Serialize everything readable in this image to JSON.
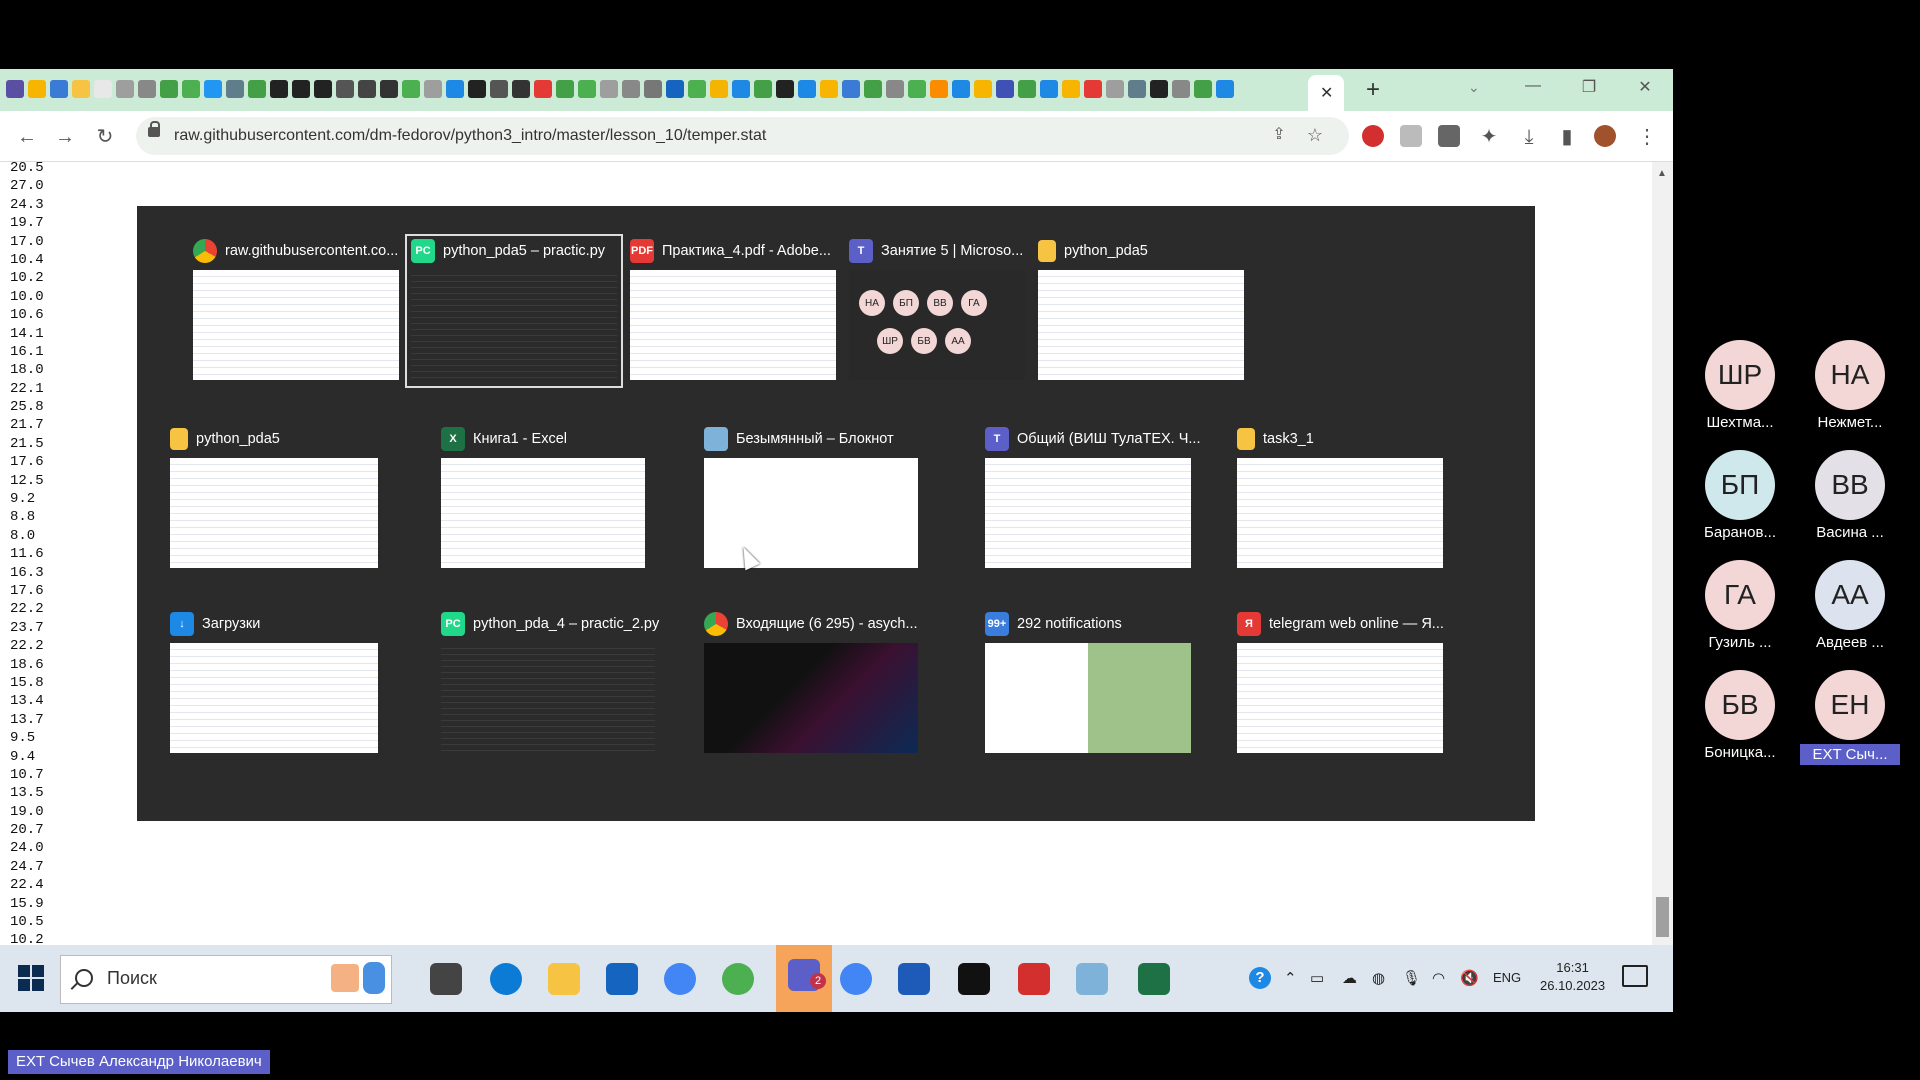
{
  "browser": {
    "active_tab_close": "✕",
    "new_tab": "+",
    "url": "raw.githubusercontent.com/dm-fedorov/python3_intro/master/lesson_10/temper.stat",
    "tab_favicon_colors": [
      "#5a4fa3",
      "#f7b500",
      "#3a7bd5",
      "#f6c343",
      "#e8e8e8",
      "#9e9e9e",
      "#888",
      "#43a047",
      "#4caf50",
      "#2196f3",
      "#607d8b",
      "#43a047",
      "#222",
      "#222",
      "#222",
      "#555",
      "#444",
      "#333",
      "#4caf50",
      "#9e9e9e",
      "#1e88e5",
      "#222",
      "#555",
      "#333",
      "#e53935",
      "#43a047",
      "#4caf50",
      "#9e9e9e",
      "#888",
      "#777",
      "#1565c0",
      "#4caf50",
      "#f4b400",
      "#1e88e5",
      "#43a047",
      "#222",
      "#1e88e5",
      "#f7b500",
      "#3a7bd5",
      "#43a047",
      "#888",
      "#4caf50",
      "#fb8c00",
      "#1e88e5",
      "#f7b500",
      "#3f51b5",
      "#43a047",
      "#1e88e5",
      "#f7b500",
      "#e53935",
      "#9e9e9e",
      "#607d8b",
      "#222",
      "#888",
      "#43a047",
      "#1e88e5"
    ]
  },
  "page": {
    "lines": [
      "20.5",
      "27.0",
      "24.3",
      "19.7",
      "17.0",
      "10.4",
      "10.2",
      "10.0",
      "10.6",
      "14.1",
      "16.1",
      "18.0",
      "22.1",
      "25.8",
      "21.7",
      "21.5",
      "17.6",
      "12.5",
      "9.2",
      "8.8",
      "8.0",
      "11.6",
      "16.3",
      "17.6",
      "22.2",
      "23.7",
      "22.2",
      "18.6",
      "15.8",
      "13.4",
      "13.7",
      "9.5",
      "9.4",
      "10.7",
      "13.5",
      "19.0",
      "20.7",
      "24.0",
      "24.7",
      "22.4",
      "15.9",
      "10.5",
      "10.2"
    ]
  },
  "switcher": {
    "windows": [
      {
        "title": "raw.githubusercontent.co...",
        "icon": "chrome-icon",
        "color": "#4285f4",
        "glyph": "",
        "thumb": "light"
      },
      {
        "title": "python_pda5 – practic.py",
        "icon": "pycharm-icon",
        "color": "#21d789",
        "glyph": "PC",
        "thumb": "dark"
      },
      {
        "title": "Практика_4.pdf - Adobe...",
        "icon": "acrobat-icon",
        "color": "#e53935",
        "glyph": "PDF",
        "thumb": "light"
      },
      {
        "title": "Занятие 5 | Microso...",
        "icon": "teams-icon",
        "color": "#5b5fc7",
        "glyph": "T",
        "thumb": "teams"
      },
      {
        "title": "python_pda5",
        "icon": "folder-icon",
        "color": "#f6c343",
        "glyph": "",
        "thumb": "light"
      },
      {
        "title": "python_pda5",
        "icon": "folder-icon",
        "color": "#f6c343",
        "glyph": "",
        "thumb": "light"
      },
      {
        "title": "Книга1 - Excel",
        "icon": "excel-icon",
        "color": "#1e7145",
        "glyph": "X",
        "thumb": "light"
      },
      {
        "title": "Безымянный – Блокнот",
        "icon": "notepad-icon",
        "color": "#7fb2d9",
        "glyph": "",
        "thumb": "white"
      },
      {
        "title": "Общий (ВИШ ТулаТЕХ. Ч...",
        "icon": "teams-icon",
        "color": "#5b5fc7",
        "glyph": "T",
        "thumb": "light"
      },
      {
        "title": "task3_1",
        "icon": "folder-icon",
        "color": "#f6c343",
        "glyph": "",
        "thumb": "light"
      },
      {
        "title": "Загрузки",
        "icon": "download-icon",
        "color": "#1e88e5",
        "glyph": "↓",
        "thumb": "light"
      },
      {
        "title": "python_pda_4 – practic_2.py",
        "icon": "pycharm-icon",
        "color": "#21d789",
        "glyph": "PC",
        "thumb": "dark"
      },
      {
        "title": "Входящие (6 295) - asych...",
        "icon": "chrome-icon",
        "color": "#4285f4",
        "glyph": "",
        "thumb": "mail"
      },
      {
        "title": "292 notifications",
        "icon": "notifications-icon",
        "color": "#3b7ddd",
        "glyph": "99+",
        "thumb": "telegram"
      },
      {
        "title": "telegram web online — Я...",
        "icon": "yandex-icon",
        "color": "#e53935",
        "glyph": "Я",
        "thumb": "light"
      }
    ],
    "teams_thumb_avatars": [
      "НА",
      "БП",
      "ВВ",
      "ГА",
      "ШР",
      "БВ",
      "АА"
    ]
  },
  "taskbar": {
    "search_placeholder": "Поиск",
    "lang": "ENG",
    "time": "16:31",
    "date": "26.10.2023",
    "apps": [
      {
        "name": "task-view-icon",
        "color": "#444"
      },
      {
        "name": "edge-icon",
        "color": "#0c7bd6"
      },
      {
        "name": "file-explorer-icon",
        "color": "#f6c343"
      },
      {
        "name": "mail-icon",
        "color": "#1565c0"
      },
      {
        "name": "chrome-icon",
        "color": "#4285f4"
      },
      {
        "name": "utorrent-icon",
        "color": "#4caf50"
      },
      {
        "name": "teams-icon",
        "color": "#5b5fc7"
      },
      {
        "name": "chrome-profile-icon",
        "color": "#4285f4"
      },
      {
        "name": "word-icon",
        "color": "#1e5bb8"
      },
      {
        "name": "pycharm-icon",
        "color": "#111"
      },
      {
        "name": "acrobat-icon",
        "color": "#d32f2f"
      },
      {
        "name": "notepad-icon",
        "color": "#7fb2d9"
      },
      {
        "name": "excel-icon",
        "color": "#1e7145"
      }
    ],
    "teams_badge": "2"
  },
  "participants": [
    {
      "initials": "ШР",
      "name": "Шехтма...",
      "color": "#f3d6d6"
    },
    {
      "initials": "НА",
      "name": "Нежмет...",
      "color": "#f3d6d6"
    },
    {
      "initials": "БП",
      "name": "Баранов...",
      "color": "#cfe8ec"
    },
    {
      "initials": "ВВ",
      "name": "Васина ...",
      "color": "#e3e0e8"
    },
    {
      "initials": "ГА",
      "name": "Гузиль ...",
      "color": "#f3d6d6"
    },
    {
      "initials": "АА",
      "name": "Авдеев ...",
      "color": "#dde3ee"
    },
    {
      "initials": "БВ",
      "name": "Боницка...",
      "color": "#f3d6d6"
    },
    {
      "initials": "ЕН",
      "name": "EXT Сыч...",
      "color": "#f3d6d6"
    }
  ],
  "presenter_label": "EXT Сычев Александр Николаевич"
}
